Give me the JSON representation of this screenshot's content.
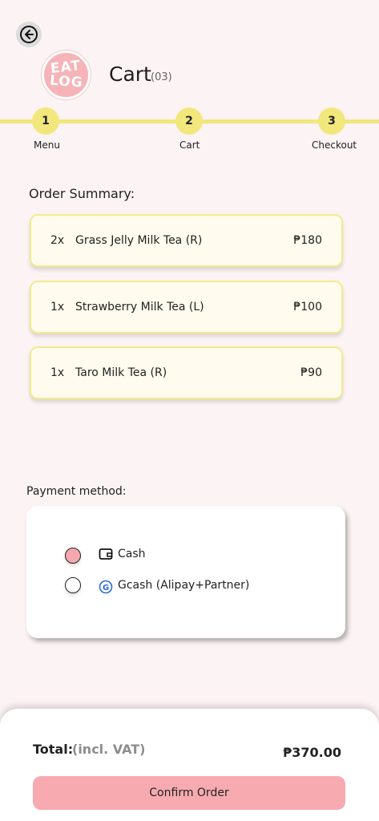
{
  "header": {
    "title": "Cart",
    "count": "(03)",
    "logo_line1": "EAT",
    "logo_line2": "LOG"
  },
  "stepper": {
    "steps": [
      {
        "number": "1",
        "label": "Menu"
      },
      {
        "number": "2",
        "label": "Cart"
      },
      {
        "number": "3",
        "label": "Checkout"
      }
    ]
  },
  "order_summary": {
    "title": "Order Summary:",
    "items": [
      {
        "qty": "2x",
        "name": "Grass Jelly Milk Tea (R)",
        "price": "₱180"
      },
      {
        "qty": "1x",
        "name": "Strawberry Milk Tea (L)",
        "price": "₱100"
      },
      {
        "qty": "1x",
        "name": "Taro Milk Tea (R)",
        "price": "₱90"
      }
    ]
  },
  "payment": {
    "label": "Payment method:",
    "options": [
      {
        "label": "Cash",
        "icon": "wallet-icon",
        "selected": true
      },
      {
        "label": "Gcash (Alipay+Partner)",
        "icon": "gcash-icon",
        "selected": false
      }
    ]
  },
  "footer": {
    "total_label": "Total:",
    "total_sub": "(incl. VAT)",
    "total_value": "₱370.00",
    "confirm_label": "Confirm Order"
  },
  "colors": {
    "background": "#fcf3f4",
    "accent_yellow": "#f2e77c",
    "accent_pink": "#f7aab0"
  }
}
